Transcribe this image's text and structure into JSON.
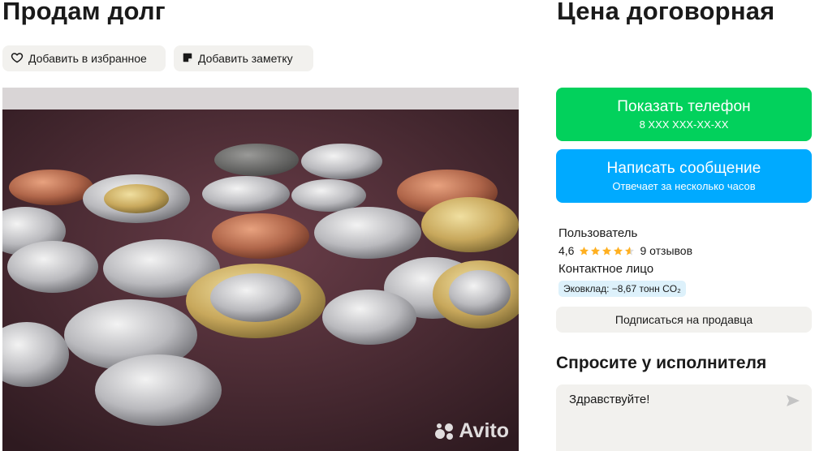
{
  "listing": {
    "title": "Продам долг",
    "price": "Цена договорная"
  },
  "actions": {
    "favorite_label": "Добавить в избранное",
    "note_label": "Добавить заметку"
  },
  "photo": {
    "watermark": "Avito"
  },
  "contact": {
    "phone_button_label": "Показать телефон",
    "phone_masked": "8 XXX XXX-XX-XX",
    "message_button_label": "Написать сообщение",
    "message_button_sub": "Отвечает за несколько часов"
  },
  "seller": {
    "name": "Пользователь",
    "rating": "4,6",
    "rating_value": 4.6,
    "rating_max": 5,
    "reviews": "9 отзывов",
    "role": "Контактное лицо",
    "eco": "Эковклад: −8,67 тонн CO₂",
    "subscribe_label": "Подписаться на продавца"
  },
  "ask": {
    "title": "Спросите у исполнителя",
    "input_value": "Здравствуйте!"
  },
  "colors": {
    "phone_button": "#02d15c",
    "message_button": "#00aaff",
    "star": "#ffb021",
    "eco_badge": "#ddf1fb"
  },
  "icons": {
    "favorite": "heart-icon",
    "note": "note-icon",
    "send": "send-icon",
    "star": "star-icon"
  }
}
